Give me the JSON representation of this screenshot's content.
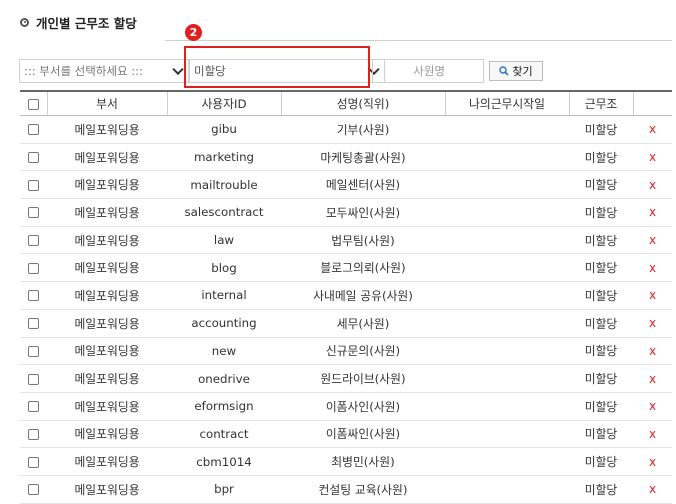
{
  "section_title": "개인별 근무조 할당",
  "step_badge": "2",
  "filters": {
    "department_placeholder": "::: 부서를 선택하세요 :::",
    "status_value": "미할당",
    "name_placeholder": "사원명",
    "find_label": "찾기"
  },
  "table": {
    "headers": [
      "부서",
      "사용자ID",
      "성명(직위)",
      "나의근무시작일",
      "근무조"
    ],
    "delete_label": "x",
    "rows": [
      {
        "dept": "메일포워딩용",
        "user_id": "gibu",
        "name": "기부(사원)",
        "start": "",
        "shift": "미할당"
      },
      {
        "dept": "메일포워딩용",
        "user_id": "marketing",
        "name": "마케팅총괄(사원)",
        "start": "",
        "shift": "미할당"
      },
      {
        "dept": "메일포워딩용",
        "user_id": "mailtrouble",
        "name": "메일센터(사원)",
        "start": "",
        "shift": "미할당"
      },
      {
        "dept": "메일포워딩용",
        "user_id": "salescontract",
        "name": "모두싸인(사원)",
        "start": "",
        "shift": "미할당"
      },
      {
        "dept": "메일포워딩용",
        "user_id": "law",
        "name": "법무팀(사원)",
        "start": "",
        "shift": "미할당"
      },
      {
        "dept": "메일포워딩용",
        "user_id": "blog",
        "name": "블로그의뢰(사원)",
        "start": "",
        "shift": "미할당"
      },
      {
        "dept": "메일포워딩용",
        "user_id": "internal",
        "name": "사내메일 공유(사원)",
        "start": "",
        "shift": "미할당"
      },
      {
        "dept": "메일포워딩용",
        "user_id": "accounting",
        "name": "세무(사원)",
        "start": "",
        "shift": "미할당"
      },
      {
        "dept": "메일포워딩용",
        "user_id": "new",
        "name": "신규문의(사원)",
        "start": "",
        "shift": "미할당"
      },
      {
        "dept": "메일포워딩용",
        "user_id": "onedrive",
        "name": "원드라이브(사원)",
        "start": "",
        "shift": "미할당"
      },
      {
        "dept": "메일포워딩용",
        "user_id": "eformsign",
        "name": "이폼사인(사원)",
        "start": "",
        "shift": "미할당"
      },
      {
        "dept": "메일포워딩용",
        "user_id": "contract",
        "name": "이폼싸인(사원)",
        "start": "",
        "shift": "미할당"
      },
      {
        "dept": "메일포워딩용",
        "user_id": "cbm1014",
        "name": "최병민(사원)",
        "start": "",
        "shift": "미할당"
      },
      {
        "dept": "메일포워딩용",
        "user_id": "bpr",
        "name": "컨설팅 교육(사원)",
        "start": "",
        "shift": "미할당"
      }
    ]
  },
  "colors": {
    "highlight": "#e02020",
    "delete": "#e02020"
  }
}
